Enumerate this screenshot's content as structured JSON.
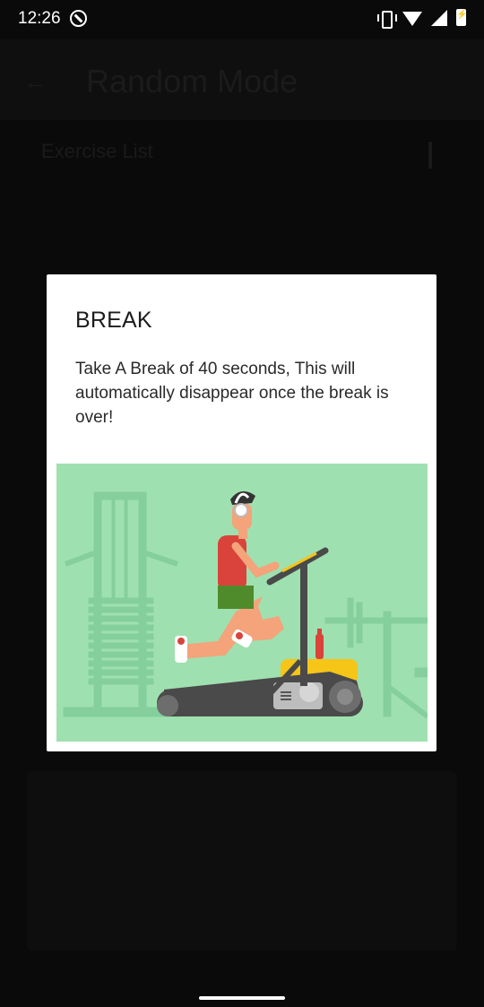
{
  "statusbar": {
    "time": "12:26",
    "icons": [
      "do-not-disturb-icon",
      "vibrate-icon",
      "wifi-icon",
      "signal-icon",
      "battery-charging-icon"
    ]
  },
  "background_app": {
    "title": "Random Mode",
    "section_title": "Exercise List"
  },
  "dialog": {
    "title": "BREAK",
    "message": "Take A Break of 40 seconds, This will automatically disappear once the break is over!",
    "illustration": "man-running-on-treadmill-illustration"
  },
  "colors": {
    "illustration_bg": "#9fe0b0",
    "treadmill_dark": "#4a4a4a",
    "treadmill_accent": "#f5c518",
    "shirt": "#d9433c",
    "shorts": "#4f8b2b"
  }
}
